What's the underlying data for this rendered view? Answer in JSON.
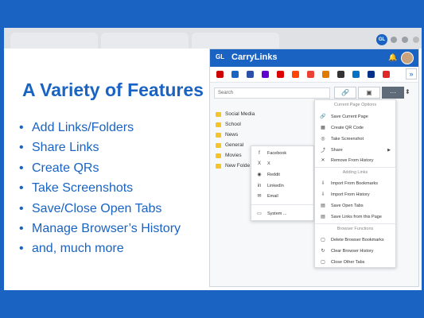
{
  "browser": {
    "avatar_initials": "GL"
  },
  "slide": {
    "title": "A Variety of Features",
    "features": [
      "Add Links/Folders",
      "Share Links",
      "Create QRs",
      "Take Screenshots",
      "Save/Close Open Tabs",
      "Manage Browser’s History",
      "and, much more"
    ]
  },
  "app": {
    "logo": "GL",
    "title": "CarryLinks",
    "search_placeholder": "Search",
    "favicons": [
      {
        "name": "CNN",
        "color": "#cc0000"
      },
      {
        "name": "GL",
        "color": "#1a63c2"
      },
      {
        "name": "shield",
        "color": "#2b50a8"
      },
      {
        "name": "yahoo",
        "color": "#5f01d1"
      },
      {
        "name": "espn",
        "color": "#d00"
      },
      {
        "name": "reddit",
        "color": "#ff4500"
      },
      {
        "name": "google",
        "color": "#ea4335"
      },
      {
        "name": "nbc",
        "color": "#e07b00"
      },
      {
        "name": "wiki",
        "color": "#333"
      },
      {
        "name": "outlook",
        "color": "#0072c6"
      },
      {
        "name": "paypal",
        "color": "#003087"
      },
      {
        "name": "flipboard",
        "color": "#e12828"
      }
    ],
    "folders": [
      "Social Media",
      "School",
      "News",
      "General",
      "Movies",
      "New Folde"
    ]
  },
  "share_menu": {
    "items": [
      {
        "icon": "f",
        "label": "Facebook"
      },
      {
        "icon": "X",
        "label": "X"
      },
      {
        "icon": "◉",
        "label": "Reddit"
      },
      {
        "icon": "in",
        "label": "LinkedIn"
      },
      {
        "icon": "✉",
        "label": "Email"
      },
      {
        "icon": "▭",
        "label": "System ..."
      }
    ]
  },
  "options_menu": {
    "current_header": "Current Page Options",
    "current_items": [
      {
        "icon": "🔗",
        "label": "Save Current Page"
      },
      {
        "icon": "▦",
        "label": "Create QR Code"
      },
      {
        "icon": "◎",
        "label": "Take Screenshot"
      },
      {
        "icon": "⤴",
        "label": "Share"
      },
      {
        "icon": "✕",
        "label": "Remove From History"
      }
    ],
    "adding_header": "Adding Links",
    "adding_items": [
      {
        "icon": "⇩",
        "label": "Import From Bookmarks"
      },
      {
        "icon": "⇩",
        "label": "Import From History"
      },
      {
        "icon": "▤",
        "label": "Save Open Tabs"
      },
      {
        "icon": "▤",
        "label": "Save Links from this Page"
      }
    ],
    "browser_header": "Browser Functions",
    "browser_items": [
      {
        "icon": "▢",
        "label": "Delete Browser Bookmarks"
      },
      {
        "icon": "↻",
        "label": "Clear Browser History"
      },
      {
        "icon": "▢",
        "label": "Close Other Tabs"
      }
    ]
  }
}
